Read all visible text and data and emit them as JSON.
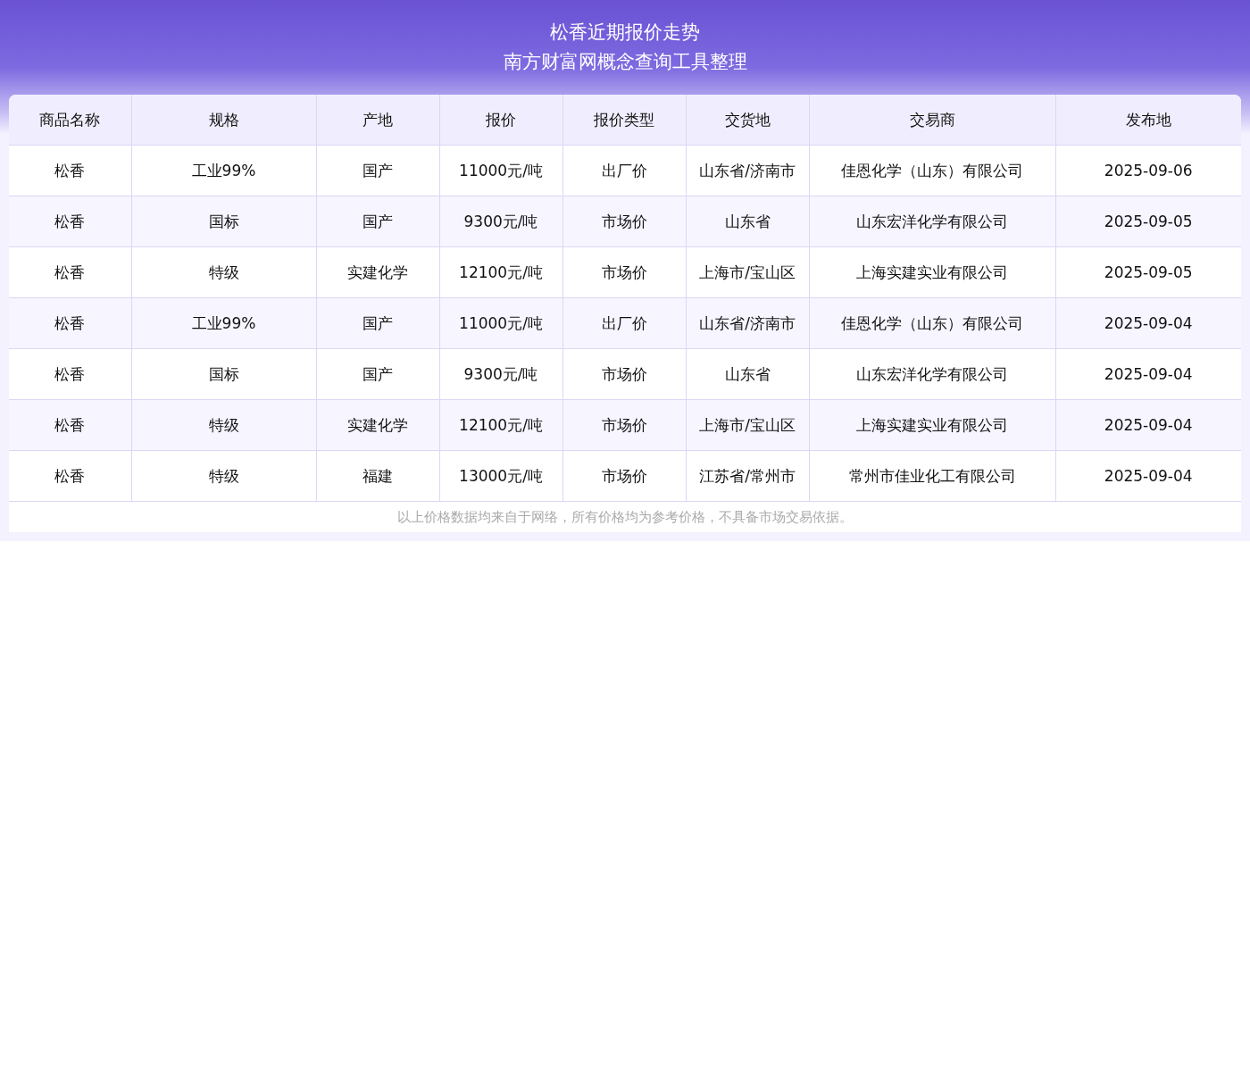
{
  "header": {
    "title": "松香近期报价走势",
    "subtitle": "南方财富网概念查询工具整理"
  },
  "table": {
    "columns": [
      "商品名称",
      "规格",
      "产地",
      "报价",
      "报价类型",
      "交货地",
      "交易商",
      "发布地"
    ],
    "rows": [
      [
        "松香",
        "工业99%",
        "国产",
        "11000元/吨",
        "出厂价",
        "山东省/济南市",
        "佳恩化学（山东）有限公司",
        "2025-09-06"
      ],
      [
        "松香",
        "国标",
        "国产",
        "9300元/吨",
        "市场价",
        "山东省",
        "山东宏洋化学有限公司",
        "2025-09-05"
      ],
      [
        "松香",
        "特级",
        "实建化学",
        "12100元/吨",
        "市场价",
        "上海市/宝山区",
        "上海实建实业有限公司",
        "2025-09-05"
      ],
      [
        "松香",
        "工业99%",
        "国产",
        "11000元/吨",
        "出厂价",
        "山东省/济南市",
        "佳恩化学（山东）有限公司",
        "2025-09-04"
      ],
      [
        "松香",
        "国标",
        "国产",
        "9300元/吨",
        "市场价",
        "山东省",
        "山东宏洋化学有限公司",
        "2025-09-04"
      ],
      [
        "松香",
        "特级",
        "实建化学",
        "12100元/吨",
        "市场价",
        "上海市/宝山区",
        "上海实建实业有限公司",
        "2025-09-04"
      ],
      [
        "松香",
        "特级",
        "福建",
        "13000元/吨",
        "市场价",
        "江苏省/常州市",
        "常州市佳业化工有限公司",
        "2025-09-04"
      ]
    ]
  },
  "footnote": "以上价格数据均来自于网络，所有价格均为参考价格，不具备市场交易依据。"
}
